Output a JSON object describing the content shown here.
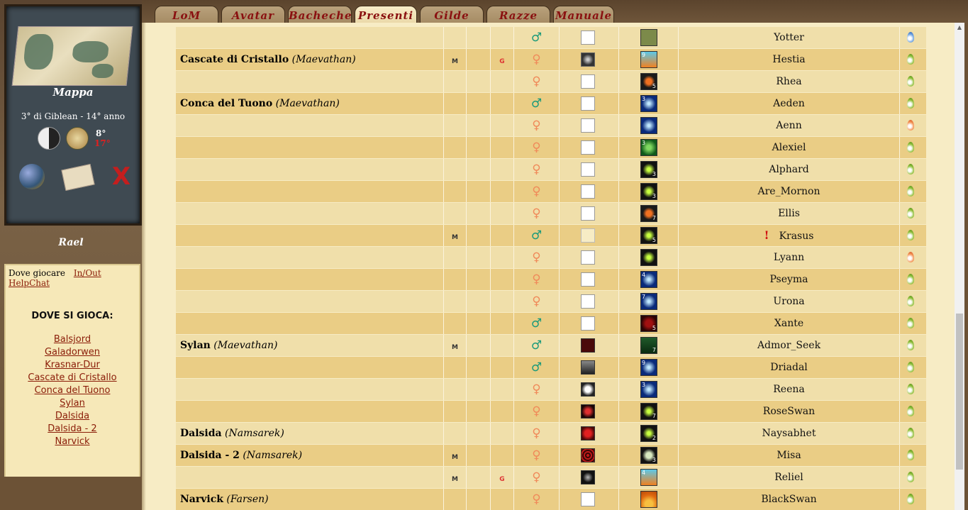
{
  "left": {
    "map_label": "Mappa",
    "date": "3° di Giblean - 14° anno",
    "temp_high": "8°",
    "temp_low": "17°",
    "close_glyph": "X",
    "user": "Rael",
    "subnav": [
      "Dove giocare",
      "In/Out",
      "HelpChat"
    ],
    "dove_title": "DOVE SI GIOCA:",
    "places": [
      "Balsjord",
      "Galadorwen",
      "Krasnar-Dur",
      "Cascate di Cristallo",
      "Conca del Tuono",
      "Sylan",
      "Dalsida",
      "Dalsida - 2",
      "Narvick"
    ]
  },
  "tabs": [
    "LoM",
    "Avatar",
    "Bacheche",
    "Presenti",
    "Gilde",
    "Razze",
    "Manuale"
  ],
  "active_tab": "Presenti",
  "icons": {
    "male": "♂",
    "female": "♀",
    "m_badge": "M",
    "g_badge": "G",
    "alert": "!"
  },
  "colors": {
    "drop_green": "#8fbf3a",
    "drop_orange": "#f39050",
    "drop_blue": "#6aa0e0",
    "male": "#1b9a7a",
    "female": "#f08a5a"
  },
  "rows": [
    {
      "place": "",
      "realm": "",
      "m": false,
      "g": false,
      "sex": "male",
      "race_num": "",
      "race_num2": "",
      "race": "elder",
      "shield": "crest",
      "name": "Yotter",
      "alert": false,
      "drop": "blue"
    },
    {
      "place": "Cascate di Cristallo",
      "realm": "(Maevathan)",
      "m": true,
      "g": true,
      "sex": "female",
      "race_num": "9",
      "race_num2": "",
      "race": "fire",
      "shield": "eye",
      "name": "Hestia",
      "alert": false,
      "drop": "green"
    },
    {
      "place": "",
      "realm": "",
      "m": false,
      "g": false,
      "sex": "female",
      "race_num": "",
      "race_num2": "5",
      "race": "fish",
      "shield": "crest",
      "name": "Rhea",
      "alert": false,
      "drop": "green"
    },
    {
      "place": "Conca del Tuono",
      "realm": "(Maevathan)",
      "m": false,
      "g": false,
      "sex": "male",
      "race_num": "3",
      "race_num2": "",
      "race": "blue",
      "shield": "crest",
      "name": "Aeden",
      "alert": false,
      "drop": "green"
    },
    {
      "place": "",
      "realm": "",
      "m": false,
      "g": false,
      "sex": "female",
      "race_num": "",
      "race_num2": "",
      "race": "blue",
      "shield": "crest",
      "name": "Aenn",
      "alert": false,
      "drop": "orange"
    },
    {
      "place": "",
      "realm": "",
      "m": false,
      "g": false,
      "sex": "female",
      "race_num": "3",
      "race_num2": "",
      "race": "tree",
      "shield": "crest",
      "name": "Alexiel",
      "alert": false,
      "drop": "green"
    },
    {
      "place": "",
      "realm": "",
      "m": false,
      "g": false,
      "sex": "female",
      "race_num": "",
      "race_num2": "3",
      "race": "butterfly",
      "shield": "crest",
      "name": "Alphard",
      "alert": false,
      "drop": "green"
    },
    {
      "place": "",
      "realm": "",
      "m": false,
      "g": false,
      "sex": "female",
      "race_num": "",
      "race_num2": "3",
      "race": "butterfly",
      "shield": "crest",
      "name": "Are_Mornon",
      "alert": false,
      "drop": "green"
    },
    {
      "place": "",
      "realm": "",
      "m": false,
      "g": false,
      "sex": "female",
      "race_num": "",
      "race_num2": "7",
      "race": "fish",
      "shield": "crest",
      "name": "Ellis",
      "alert": false,
      "drop": "green"
    },
    {
      "place": "",
      "realm": "",
      "m": true,
      "g": false,
      "sex": "male",
      "race_num": "",
      "race_num2": "5",
      "race": "butterfly",
      "shield": "lily",
      "name": "Krasus",
      "alert": true,
      "drop": "green"
    },
    {
      "place": "",
      "realm": "",
      "m": false,
      "g": false,
      "sex": "female",
      "race_num": "",
      "race_num2": "",
      "race": "butterfly",
      "shield": "crest",
      "name": "Lyann",
      "alert": false,
      "drop": "orange"
    },
    {
      "place": "",
      "realm": "",
      "m": false,
      "g": false,
      "sex": "female",
      "race_num": "4",
      "race_num2": "",
      "race": "blue",
      "shield": "crest",
      "name": "Pseyma",
      "alert": false,
      "drop": "green"
    },
    {
      "place": "",
      "realm": "",
      "m": false,
      "g": false,
      "sex": "female",
      "race_num": "7",
      "race_num2": "",
      "race": "blue",
      "shield": "crest",
      "name": "Urona",
      "alert": false,
      "drop": "green"
    },
    {
      "place": "",
      "realm": "",
      "m": false,
      "g": false,
      "sex": "male",
      "race_num": "",
      "race_num2": "5",
      "race": "blood",
      "shield": "crest",
      "name": "Xante",
      "alert": false,
      "drop": "green"
    },
    {
      "place": "Sylan",
      "realm": "(Maevathan)",
      "m": true,
      "g": false,
      "sex": "male",
      "race_num": "",
      "race_num2": "7",
      "race": "shieldgreen",
      "shield": "darkred",
      "name": "Admor_Seek",
      "alert": false,
      "drop": "green"
    },
    {
      "place": "",
      "realm": "",
      "m": false,
      "g": false,
      "sex": "male",
      "race_num": "9",
      "race_num2": "",
      "race": "blue",
      "shield": "music",
      "name": "Driadal",
      "alert": false,
      "drop": "green"
    },
    {
      "place": "",
      "realm": "",
      "m": false,
      "g": false,
      "sex": "female",
      "race_num": "3",
      "race_num2": "",
      "race": "blue",
      "shield": "mask",
      "name": "Reena",
      "alert": false,
      "drop": "green"
    },
    {
      "place": "",
      "realm": "",
      "m": false,
      "g": false,
      "sex": "female",
      "race_num": "",
      "race_num2": "7",
      "race": "butterfly",
      "shield": "rose",
      "name": "RoseSwan",
      "alert": false,
      "drop": "green"
    },
    {
      "place": "Dalsida",
      "realm": "(Namsarek)",
      "m": false,
      "g": false,
      "sex": "female",
      "race_num": "",
      "race_num2": "2",
      "race": "butterfly",
      "shield": "redflower",
      "name": "Naysabhet",
      "alert": false,
      "drop": "green"
    },
    {
      "place": "Dalsida - 2",
      "realm": "(Namsarek)",
      "m": true,
      "g": false,
      "sex": "female",
      "race_num": "",
      "race_num2": "3",
      "race": "skull",
      "shield": "redpattern",
      "name": "Misa",
      "alert": false,
      "drop": "green"
    },
    {
      "place": "",
      "realm": "",
      "m": true,
      "g": true,
      "sex": "female",
      "race_num": "4",
      "race_num2": "",
      "race": "fire",
      "shield": "dark",
      "name": "Reliel",
      "alert": false,
      "drop": "green"
    },
    {
      "place": "Narvick",
      "realm": "(Farsen)",
      "m": false,
      "g": false,
      "sex": "female",
      "race_num": "",
      "race_num2": "",
      "race": "shell",
      "shield": "crest",
      "name": "BlackSwan",
      "alert": false,
      "drop": "green"
    }
  ]
}
